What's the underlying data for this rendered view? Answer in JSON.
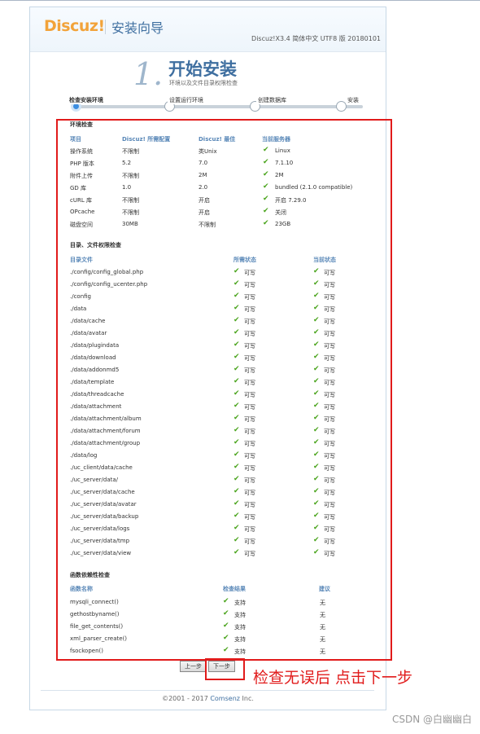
{
  "header": {
    "logo": "Discuz!",
    "wizard_title": "安装向导",
    "version": "Discuz!X3.4 简体中文 UTF8 版 20180101"
  },
  "step": {
    "number": "1.",
    "title": "开始安装",
    "subtitle": "环境以及文件目录权限检查"
  },
  "progress": [
    "检查安装环境",
    "设置运行环境",
    "创建数据库",
    "安装"
  ],
  "env": {
    "title": "环境检查",
    "headers": [
      "项目",
      "Discuz! 所需配置",
      "Discuz! 最佳",
      "当前服务器"
    ],
    "rows": [
      [
        "操作系统",
        "不限制",
        "类Unix",
        "Linux"
      ],
      [
        "PHP 版本",
        "5.2",
        "7.0",
        "7.1.10"
      ],
      [
        "附件上传",
        "不限制",
        "2M",
        "2M"
      ],
      [
        "GD 库",
        "1.0",
        "2.0",
        "bundled (2.1.0 compatible)"
      ],
      [
        "cURL 库",
        "不限制",
        "开启",
        "开启 7.29.0"
      ],
      [
        "OPcache",
        "不限制",
        "开启",
        "关闭"
      ],
      [
        "磁盘空间",
        "30MB",
        "不限制",
        "23GB"
      ]
    ]
  },
  "dirs": {
    "title": "目录、文件权限检查",
    "headers": [
      "目录文件",
      "所需状态",
      "当前状态"
    ],
    "status": "可写",
    "rows": [
      "./config/config_global.php",
      "./config/config_ucenter.php",
      "./config",
      "./data",
      "./data/cache",
      "./data/avatar",
      "./data/plugindata",
      "./data/download",
      "./data/addonmd5",
      "./data/template",
      "./data/threadcache",
      "./data/attachment",
      "./data/attachment/album",
      "./data/attachment/forum",
      "./data/attachment/group",
      "./data/log",
      "./uc_client/data/cache",
      "./uc_server/data/",
      "./uc_server/data/cache",
      "./uc_server/data/avatar",
      "./uc_server/data/backup",
      "./uc_server/data/logs",
      "./uc_server/data/tmp",
      "./uc_server/data/view"
    ]
  },
  "funcs": {
    "title": "函数依赖性检查",
    "headers": [
      "函数名称",
      "检查结果",
      "建议"
    ],
    "result": "支持",
    "advice": "无",
    "rows": [
      "mysqli_connect()",
      "gethostbyname()",
      "file_get_contents()",
      "xml_parser_create()",
      "fsockopen()"
    ]
  },
  "buttons": {
    "prev": "上一步",
    "next": "下一步"
  },
  "annotation": "检查无误后 点击下一步",
  "footer": {
    "prefix": "©2001 - 2017 ",
    "brand": "Comsenz",
    "suffix": " Inc."
  },
  "watermark": "CSDN @白幽幽白",
  "colors": {
    "accent": "#3f6fa0",
    "check": "#4aa41d",
    "highlight": "#e11b1b",
    "logo": "#f2a33a"
  }
}
